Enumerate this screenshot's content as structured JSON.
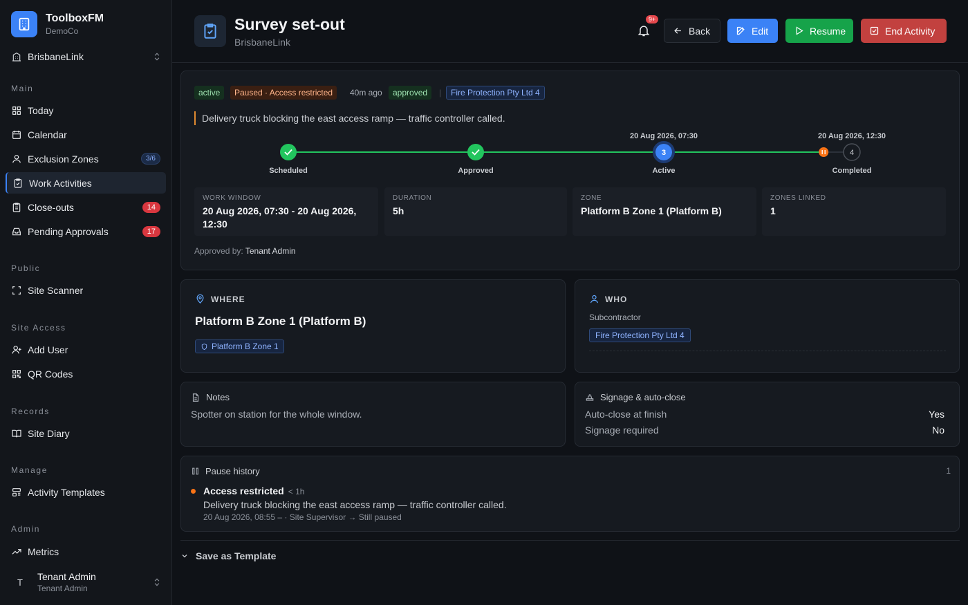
{
  "brand": {
    "name": "ToolboxFM",
    "org": "DemoCo"
  },
  "site": {
    "name": "BrisbaneLink"
  },
  "sidebar": {
    "sections": [
      {
        "label": "Main",
        "items": [
          {
            "label": "Today"
          },
          {
            "label": "Calendar"
          },
          {
            "label": "Exclusion Zones",
            "badge": "3/6"
          },
          {
            "label": "Work Activities",
            "active": true
          },
          {
            "label": "Close-outs",
            "badge": "14"
          },
          {
            "label": "Pending Approvals",
            "badge": "17"
          }
        ]
      },
      {
        "label": "Public",
        "items": [
          {
            "label": "Site Scanner"
          }
        ]
      },
      {
        "label": "Site Access",
        "items": [
          {
            "label": "Add User"
          },
          {
            "label": "QR Codes"
          }
        ]
      },
      {
        "label": "Records",
        "items": [
          {
            "label": "Site Diary"
          }
        ]
      },
      {
        "label": "Manage",
        "items": [
          {
            "label": "Activity Templates"
          }
        ]
      },
      {
        "label": "Admin",
        "items": [
          {
            "label": "Metrics"
          }
        ]
      }
    ],
    "user": {
      "initial": "T",
      "name": "Tenant Admin",
      "role": "Tenant Admin"
    }
  },
  "header": {
    "title": "Survey set-out",
    "subtitle": "BrisbaneLink",
    "notification_badge": "9+",
    "buttons": {
      "back": "Back",
      "edit": "Edit",
      "resume": "Resume",
      "end": "End Activity"
    }
  },
  "status": {
    "chips": {
      "state": "active",
      "paused": "Paused · Access restricted",
      "ago": "40m ago",
      "approval": "approved",
      "separator": "|",
      "org": "Fire Protection Pty Ltd 4"
    },
    "pause_note": "Delivery truck blocking the east access ramp — traffic controller called.",
    "timeline": {
      "steps": [
        {
          "label": "Scheduled",
          "state": "done",
          "date": ""
        },
        {
          "label": "Approved",
          "state": "done",
          "date": ""
        },
        {
          "label": "Active",
          "state": "current",
          "number": "3",
          "date": "20 Aug 2026, 07:30"
        },
        {
          "label": "Completed",
          "state": "pending",
          "number": "4",
          "date": "20 Aug 2026, 12:30"
        }
      ],
      "progress": 0.5,
      "pause_marker": 0.85
    },
    "info": {
      "work_window": {
        "label": "WORK WINDOW",
        "value": "20 Aug 2026, 07:30 - 20 Aug 2026, 12:30"
      },
      "duration": {
        "label": "DURATION",
        "value": "5h"
      },
      "zone": {
        "label": "ZONE",
        "value": "Platform B Zone 1 (Platform B)"
      },
      "zones_linked": {
        "label": "ZONES LINKED",
        "value": "1"
      }
    },
    "approved_by_label": "Approved by:",
    "approved_by": "Tenant Admin"
  },
  "where": {
    "heading": "WHERE",
    "title": "Platform B Zone 1 (Platform B)",
    "zone_chip": "Platform B Zone 1"
  },
  "who": {
    "heading": "WHO",
    "label": "Subcontractor",
    "org_chip": "Fire Protection Pty Ltd 4"
  },
  "notes": {
    "heading": "Notes",
    "text": "Spotter on station for the whole window."
  },
  "signage": {
    "heading": "Signage & auto-close",
    "rows": [
      {
        "label": "Auto-close at finish",
        "value": "Yes"
      },
      {
        "label": "Signage required",
        "value": "No"
      }
    ]
  },
  "pause_history": {
    "heading": "Pause history",
    "count": "1",
    "entry": {
      "title": "Access restricted",
      "duration": "< 1h",
      "reason": "Delivery truck blocking the east access ramp — traffic controller called.",
      "meta": "20 Aug 2026, 08:55 – · Site Supervisor → Still paused"
    }
  },
  "save_template": {
    "label": "Save as Template"
  },
  "colors": {
    "accent": "#3b82f6",
    "success": "#22c55e",
    "danger": "#c2413f",
    "warning": "#f97316",
    "background": "#0f1217"
  }
}
